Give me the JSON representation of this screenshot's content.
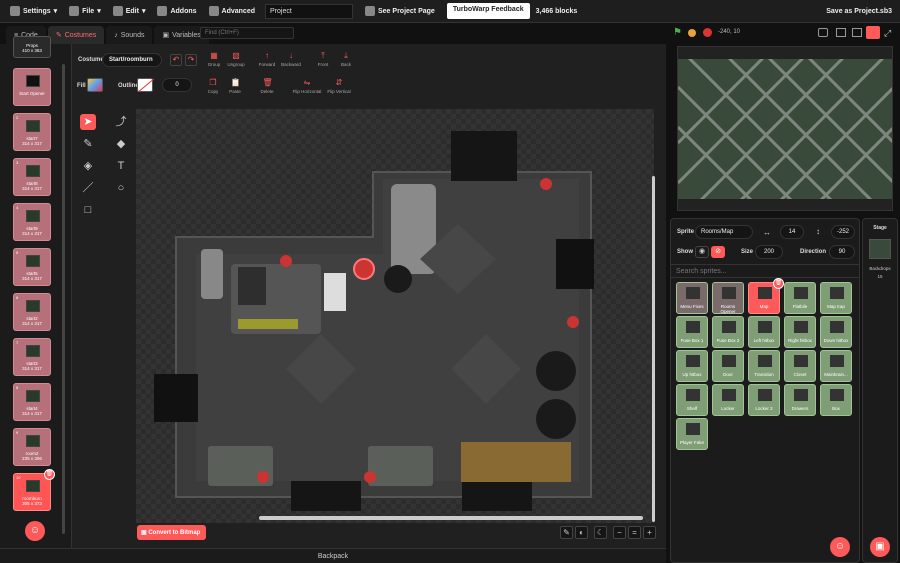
{
  "menu": {
    "settings": "Settings",
    "file": "File",
    "edit": "Edit",
    "addons": "Addons",
    "advanced": "Advanced",
    "project_name": "Project",
    "see_project_page": "See Project Page",
    "feedback": "TurboWarp Feedback",
    "block_count": "3,466 blocks",
    "save_as": "Save as Project.sb3"
  },
  "tabs": {
    "code": "Code",
    "costumes": "Costumes",
    "sounds": "Sounds",
    "variables": "Variables"
  },
  "find": {
    "placeholder": "Find (Ctrl+F)"
  },
  "costumes": [
    {
      "num": "",
      "name": "Props",
      "size": "410 x 363"
    },
    {
      "num": "",
      "name": "Start Opener",
      "size": ""
    },
    {
      "num": "2",
      "name": "start7",
      "size": "314 x 317"
    },
    {
      "num": "3",
      "name": "start8",
      "size": "314 x 317"
    },
    {
      "num": "4",
      "name": "start9",
      "size": "314 x 317"
    },
    {
      "num": "5",
      "name": "start5",
      "size": "314 x 317"
    },
    {
      "num": "6",
      "name": "start2",
      "size": "314 x 317"
    },
    {
      "num": "7",
      "name": "start3",
      "size": "314 x 317"
    },
    {
      "num": "8",
      "name": "start4",
      "size": "314 x 317"
    },
    {
      "num": "9",
      "name": "room2",
      "size": "235 x 306"
    },
    {
      "num": "10",
      "name": "roomburn",
      "size": "305 x 373"
    }
  ],
  "paint": {
    "costume_label": "Costume",
    "costume_name": "Start/roomburn",
    "group": "Group",
    "ungroup": "Ungroup",
    "forward": "Forward",
    "backward": "Backward",
    "front": "Front",
    "back": "Back",
    "fill": "Fill",
    "outline": "Outline",
    "outline_width": "0",
    "copy": "Copy",
    "paste": "Paste",
    "delete": "Delete",
    "flip_h": "Flip Horizontal",
    "flip_v": "Flip Vertical",
    "convert": "Convert to Bitmap"
  },
  "controls": {
    "coords": "-240, 10"
  },
  "backpack": "Backpack",
  "sprite_info": {
    "sprite_label": "Sprite",
    "sprite_name": "Rooms/Map",
    "x": "14",
    "y": "-252",
    "show_label": "Show",
    "size_label": "Size",
    "size": "200",
    "direction_label": "Direction",
    "direction": "90"
  },
  "search": {
    "placeholder": "Search sprites..."
  },
  "sprites": [
    {
      "name": "Menu Fixes",
      "selected": false
    },
    {
      "name": "Rooms Opener",
      "selected": false
    },
    {
      "name": "Map",
      "selected": true
    },
    {
      "name": "Flatbile",
      "selected": false
    },
    {
      "name": "Map trap",
      "selected": false
    },
    {
      "name": "Fuse Box 1",
      "selected": false
    },
    {
      "name": "Fuse Box 2",
      "selected": false
    },
    {
      "name": "Left hitbox",
      "selected": false
    },
    {
      "name": "Right hitbox",
      "selected": false
    },
    {
      "name": "Down hitbox",
      "selected": false
    },
    {
      "name": "Up hitbox",
      "selected": false
    },
    {
      "name": "Door",
      "selected": false
    },
    {
      "name": "Transition",
      "selected": false
    },
    {
      "name": "Closet",
      "selected": false
    },
    {
      "name": "Mainbrain...",
      "selected": false
    },
    {
      "name": "Shelf",
      "selected": false
    },
    {
      "name": "Locker",
      "selected": false
    },
    {
      "name": "Locker 2",
      "selected": false
    },
    {
      "name": "Drawers",
      "selected": false
    },
    {
      "name": "Box",
      "selected": false
    },
    {
      "name": "Player Fake",
      "selected": false
    }
  ],
  "stage": {
    "label": "Stage",
    "backdrops_label": "Backdrops",
    "backdrops_count": "15"
  },
  "colors": {
    "accent": "#ff5a5a",
    "sprite_tile": "#7f9e76",
    "costume_tile": "#b5707a"
  }
}
